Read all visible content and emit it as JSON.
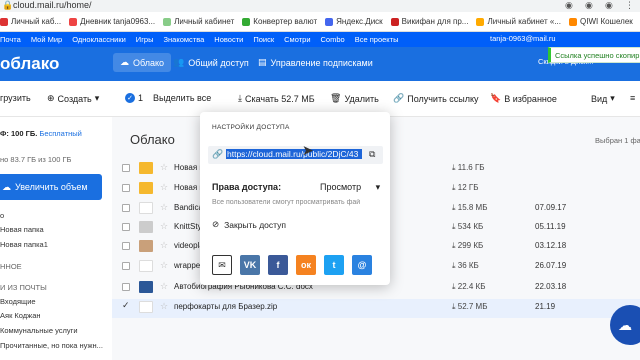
{
  "browser": {
    "url": "cloud.mail.ru/home/",
    "account": "tanja-0963@mail.ru",
    "bookmarks": [
      {
        "label": "Личный каб...",
        "color": "#d33"
      },
      {
        "label": "Дневник tanja0963...",
        "color": "#e44"
      },
      {
        "label": "Личный кабинет",
        "color": "#8c8"
      },
      {
        "label": "Конвертер валют",
        "color": "#3a3"
      },
      {
        "label": "Яндекс.Диск",
        "color": "#46e"
      },
      {
        "label": "Викифан для пр...",
        "color": "#c22"
      },
      {
        "label": "Личный кабинет «...",
        "color": "#fa0"
      },
      {
        "label": "QIWI Кошелек",
        "color": "#f80"
      }
    ]
  },
  "portal": {
    "links": [
      "Почта",
      "Мой Мир",
      "Одноклассники",
      "Игры",
      "Знакомства",
      "Новости",
      "Поиск",
      "Смотри",
      "Combo",
      "Все проекты"
    ],
    "user": "tanja-0963@mail.ru"
  },
  "toast": "Ссылка успешно скопир",
  "header": {
    "logo": "облако",
    "tabs": [
      "Облако",
      "Общий доступ",
      "Управление подписками"
    ],
    "right": "Скидки в Диск..."
  },
  "toolbar": {
    "upload": "грузить",
    "create": "Создать",
    "selected_count": "1",
    "select_all": "Выделить все",
    "download": "Скачать 52.7 МБ",
    "delete": "Удалить",
    "get_link": "Получить ссылку",
    "to_favorites": "В избранное",
    "view": "Вид"
  },
  "sidebar": {
    "tariff": "Ф: 100 ГБ.",
    "tariff_link": "Бесплатный",
    "used": "но 83.7 ГБ из 100 ГБ",
    "upgrade": "Увеличить объем",
    "items": [
      "о",
      "Новая папка",
      "Новая папка1",
      "ННОЕ",
      "И ИЗ ПОЧТЫ",
      "Входящие",
      "Аяк Коджан",
      "Коммунальные услуги",
      "Прочитанные, но пока нужн..."
    ]
  },
  "main": {
    "breadcrumb": "Облако",
    "selected_info": "Выбран 1 файл",
    "rows": [
      {
        "name": "Новая па",
        "size": "11.6 ГБ",
        "date": "",
        "thumb": "#f5b82e",
        "checked": false
      },
      {
        "name": "Новая па",
        "size": "12 ГБ",
        "date": "",
        "thumb": "#f5b82e",
        "checked": false
      },
      {
        "name": "Bandicam",
        "size": "15.8 МБ",
        "date": "07.09.17",
        "thumb": "#fff",
        "checked": false
      },
      {
        "name": "KnittStyle",
        "size": "534 КБ",
        "date": "05.11.19",
        "thumb": "#ccc",
        "checked": false
      },
      {
        "name": "videoplay",
        "size": "299 КБ",
        "date": "03.12.18",
        "thumb": "#c9a07a",
        "checked": false
      },
      {
        "name": "wrapper.",
        "size": "36 КБ",
        "date": "26.07.19",
        "thumb": "#fff",
        "checked": false
      },
      {
        "name": "Автобиография Рыбникова С.С. docx",
        "size": "22.4 КБ",
        "date": "22.03.18",
        "thumb": "#2b5797",
        "checked": false
      },
      {
        "name": "перфокарты для Бразер.zip",
        "size": "52.7 МБ",
        "date": "21.19",
        "thumb": "#fff",
        "checked": true
      }
    ]
  },
  "modal": {
    "title": "НАСТРОЙКИ ДОСТУПА",
    "url": "https://cloud.mail.ru/public/2DjC/43",
    "perm_label": "Права доступа:",
    "perm_value": "Просмотр",
    "perm_hint": "Все пользователи смогут просматривать фай",
    "close_access": "Закрыть доступ",
    "shares": [
      {
        "name": "email",
        "label": "✉",
        "color": "#ffffff",
        "fg": "#333"
      },
      {
        "name": "vk",
        "label": "VK",
        "color": "#4a76a8",
        "fg": "#fff"
      },
      {
        "name": "facebook",
        "label": "f",
        "color": "#3b5998",
        "fg": "#fff"
      },
      {
        "name": "odnoklassniki",
        "label": "ок",
        "color": "#f58220",
        "fg": "#fff"
      },
      {
        "name": "twitter",
        "label": "t",
        "color": "#1da1f2",
        "fg": "#fff"
      },
      {
        "name": "myworld",
        "label": "@",
        "color": "#2a82e0",
        "fg": "#fff"
      }
    ]
  }
}
